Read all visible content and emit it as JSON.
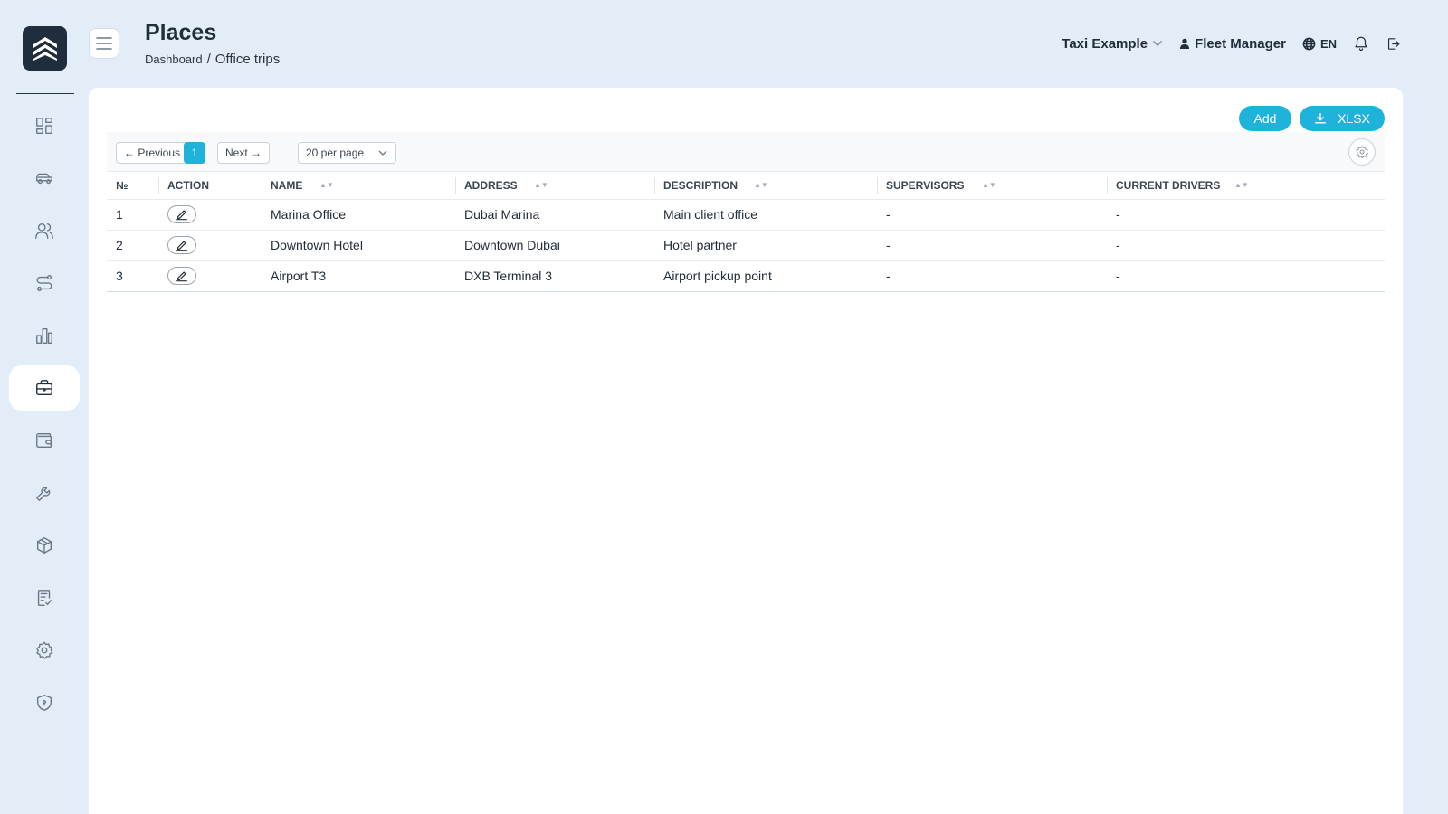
{
  "header": {
    "title": "Places",
    "breadcrumb": {
      "root": "Dashboard",
      "separator": "/",
      "current": "Office trips"
    },
    "company": "Taxi Example",
    "user": "Fleet Manager",
    "language": "EN"
  },
  "sidebar": {
    "items": [
      {
        "icon": "dashboard-icon"
      },
      {
        "icon": "car-icon"
      },
      {
        "icon": "users-icon"
      },
      {
        "icon": "route-icon"
      },
      {
        "icon": "chart-icon"
      },
      {
        "icon": "briefcase-icon",
        "active": true
      },
      {
        "icon": "wallet-icon"
      },
      {
        "icon": "wrench-icon"
      },
      {
        "icon": "package-icon"
      },
      {
        "icon": "checklist-icon"
      },
      {
        "icon": "gear-icon"
      },
      {
        "icon": "shield-icon"
      }
    ]
  },
  "actions": {
    "add_label": "Add",
    "xlsx_label": "XLSX"
  },
  "pagination": {
    "previous_label": "← Previous",
    "current_page": "1",
    "next_label": "Next →",
    "per_page_label": "20 per page"
  },
  "table": {
    "columns": [
      "№",
      "ACTION",
      "NAME",
      "ADDRESS",
      "DESCRIPTION",
      "SUPERVISORS",
      "CURRENT DRIVERS"
    ],
    "rows": [
      {
        "num": "1",
        "name": "Marina Office",
        "address": "Dubai Marina",
        "description": "Main client office",
        "supervisors": "-",
        "drivers": "-"
      },
      {
        "num": "2",
        "name": "Downtown Hotel",
        "address": "Downtown Dubai",
        "description": "Hotel partner",
        "supervisors": "-",
        "drivers": "-"
      },
      {
        "num": "3",
        "name": "Airport T3",
        "address": "DXB Terminal 3",
        "description": "Airport pickup point",
        "supervisors": "-",
        "drivers": "-"
      }
    ]
  },
  "colors": {
    "accent": "#1fb3dc",
    "background": "#e3edf7",
    "logo": "#1f2d3d"
  }
}
